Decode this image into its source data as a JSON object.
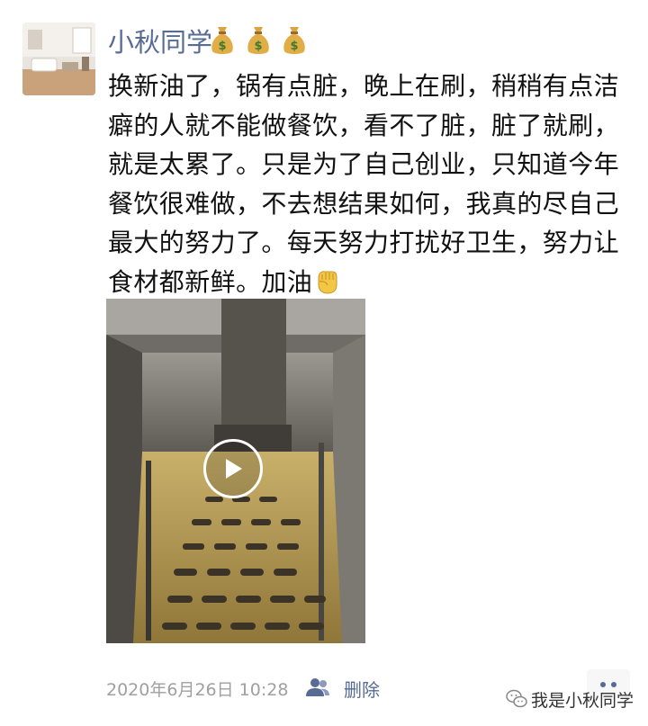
{
  "post": {
    "author": "小秋同学",
    "author_emojis": [
      "money-bag",
      "money-bag",
      "money-bag"
    ],
    "text_lines": [
      "换新油了，锅有点脏，晚上在刷，稍稍有点洁",
      "癖的人就不能做餐饮，看不了脏，脏了就刷，",
      "就是太累了。只是为了自己创业，只知道今年",
      "餐饮很难做，不去想结果如何，我真的尽自己",
      "最大的努力了。每天努力打扰好卫生，努力让",
      "食材都新鲜。加油"
    ],
    "trailing_emoji": "fist-emoji",
    "timestamp": "2020年6月26日 10:28",
    "delete_label": "删除"
  },
  "watermark": {
    "text": "我是小秋同学"
  },
  "colors": {
    "link": "#576b95",
    "meta": "#a0a0a0",
    "text": "#111111"
  }
}
